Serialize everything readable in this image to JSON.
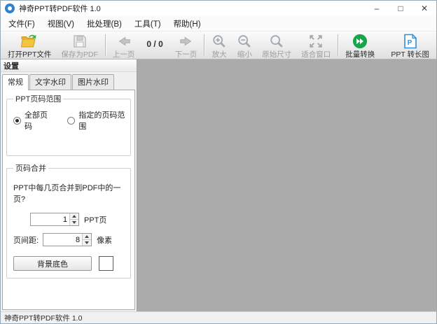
{
  "window": {
    "title": "神奇PPT转PDF软件 1.0"
  },
  "icons": {
    "minimize": "–",
    "maximize": "□",
    "close": "✕"
  },
  "menu": {
    "items": [
      {
        "label": "文件(F)"
      },
      {
        "label": "视图(V)"
      },
      {
        "label": "批处理(B)"
      },
      {
        "label": "工具(T)"
      },
      {
        "label": "帮助(H)"
      }
    ]
  },
  "toolbar": {
    "open_label": "打开PPT文件",
    "save_label": "保存为PDF",
    "prev_label": "上一页",
    "counter": "0 / 0",
    "next_label": "下一页",
    "zoom_in_label": "放大",
    "zoom_out_label": "缩小",
    "original_size_label": "原始尺寸",
    "fit_window_label": "适合窗口",
    "batch_convert_label": "批量转换",
    "ppt_long_image_label": "PPT 转长图",
    "batch_green": "#17a44c",
    "long_image_blue": "#2e8fd8"
  },
  "panel": {
    "header": "设置",
    "tabs": [
      {
        "label": "常规",
        "active": true
      },
      {
        "label": "文字水印",
        "active": false
      },
      {
        "label": "图片水印",
        "active": false
      }
    ],
    "page_range_group": {
      "legend": "PPT页码范围",
      "radio_all": "全部页码",
      "radio_specified": "指定的页码范围"
    },
    "merge_group": {
      "legend": "页码合并",
      "question": "PPT中每几页合并到PDF中的一页?",
      "pages_value": "1",
      "pages_unit": "PPT页",
      "spacing_label": "页间距:",
      "spacing_value": "8",
      "spacing_unit": "像素",
      "bg_button_label": "背景底色",
      "bg_color": "#ffffff"
    }
  },
  "statusbar": {
    "text": "神奇PPT转PDF软件 1.0"
  }
}
